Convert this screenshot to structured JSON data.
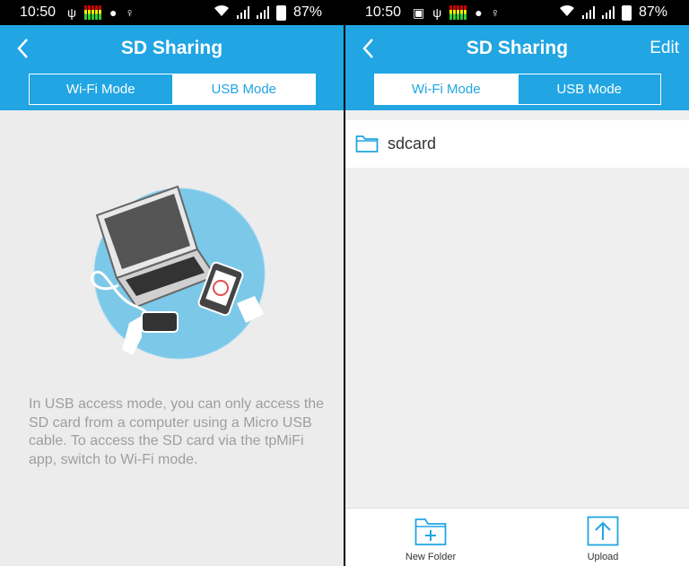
{
  "left": {
    "status": {
      "time": "10:50",
      "battery": "87%"
    },
    "header": {
      "title": "SD Sharing"
    },
    "tabs": [
      {
        "label": "Wi-Fi Mode",
        "active": false
      },
      {
        "label": "USB Mode",
        "active": true
      }
    ],
    "description": "In USB access mode, you can only access the SD card from a computer using a Micro USB cable. To access the SD card via the tpMiFi app, switch to Wi-Fi mode."
  },
  "right": {
    "status": {
      "time": "10:50",
      "battery": "87%"
    },
    "header": {
      "title": "SD Sharing",
      "edit_label": "Edit"
    },
    "tabs": [
      {
        "label": "Wi-Fi Mode",
        "active": true
      },
      {
        "label": "USB Mode",
        "active": false
      }
    ],
    "files": [
      {
        "name": "sdcard",
        "icon": "folder-icon"
      }
    ],
    "bottom_bar": {
      "new_folder_label": "New Folder",
      "upload_label": "Upload"
    }
  },
  "colors": {
    "accent": "#21a5e3",
    "background": "#ececec",
    "text_muted": "#9e9e9e"
  }
}
